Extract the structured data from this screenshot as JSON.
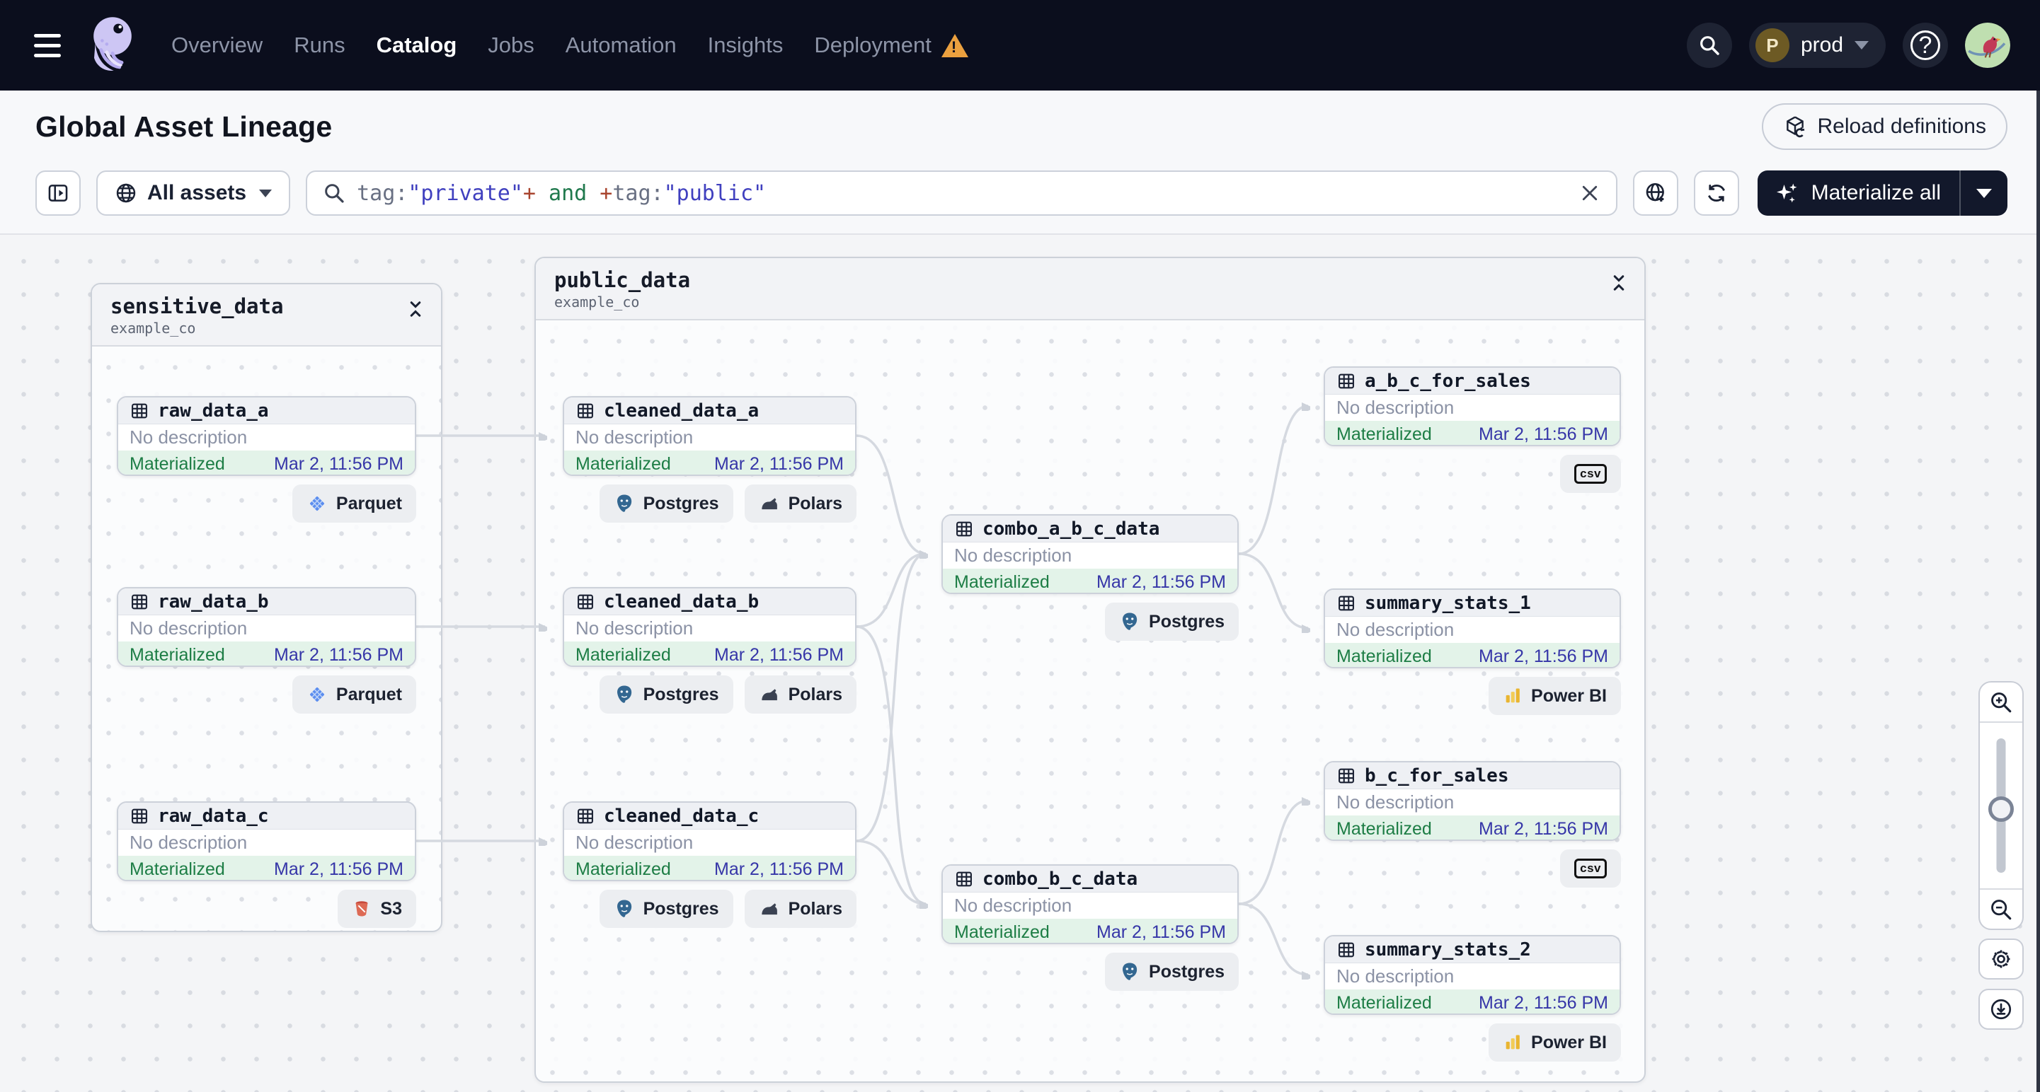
{
  "nav": {
    "items": [
      {
        "label": "Overview"
      },
      {
        "label": "Runs"
      },
      {
        "label": "Catalog"
      },
      {
        "label": "Jobs"
      },
      {
        "label": "Automation"
      },
      {
        "label": "Insights"
      },
      {
        "label": "Deployment"
      }
    ],
    "active_item": "Catalog",
    "deployment_warning": true,
    "environment": {
      "initial": "P",
      "label": "prod"
    }
  },
  "header": {
    "title": "Global Asset Lineage",
    "reload_label": "Reload definitions"
  },
  "toolbar": {
    "scope_label": "All assets",
    "materialize_label": "Materialize all",
    "query_segments": [
      {
        "text": "tag:",
        "color": "#697083"
      },
      {
        "text": "\"private\"",
        "color": "#4040bf"
      },
      {
        "text": "+",
        "color": "#a8442e"
      },
      {
        "text": " and ",
        "color": "#20794d"
      },
      {
        "text": "+",
        "color": "#a8442e"
      },
      {
        "text": "tag:",
        "color": "#697083"
      },
      {
        "text": "\"public\"",
        "color": "#4040bf"
      }
    ]
  },
  "graph": {
    "groups": [
      {
        "name": "sensitive_data",
        "repo": "example_co"
      },
      {
        "name": "public_data",
        "repo": "example_co"
      }
    ],
    "nodes": [
      {
        "name": "raw_data_a",
        "description": "No description",
        "status": "Materialized",
        "timestamp": "Mar 2, 11:56 PM",
        "badges": [
          {
            "icon": "parquet-icon",
            "label": "Parquet"
          }
        ]
      },
      {
        "name": "raw_data_b",
        "description": "No description",
        "status": "Materialized",
        "timestamp": "Mar 2, 11:56 PM",
        "badges": [
          {
            "icon": "parquet-icon",
            "label": "Parquet"
          }
        ]
      },
      {
        "name": "raw_data_c",
        "description": "No description",
        "status": "Materialized",
        "timestamp": "Mar 2, 11:56 PM",
        "badges": [
          {
            "icon": "s3-icon",
            "label": "S3"
          }
        ]
      },
      {
        "name": "cleaned_data_a",
        "description": "No description",
        "status": "Materialized",
        "timestamp": "Mar 2, 11:56 PM",
        "badges": [
          {
            "icon": "postgres-icon",
            "label": "Postgres"
          },
          {
            "icon": "polars-icon",
            "label": "Polars"
          }
        ]
      },
      {
        "name": "cleaned_data_b",
        "description": "No description",
        "status": "Materialized",
        "timestamp": "Mar 2, 11:56 PM",
        "badges": [
          {
            "icon": "postgres-icon",
            "label": "Postgres"
          },
          {
            "icon": "polars-icon",
            "label": "Polars"
          }
        ]
      },
      {
        "name": "cleaned_data_c",
        "description": "No description",
        "status": "Materialized",
        "timestamp": "Mar 2, 11:56 PM",
        "badges": [
          {
            "icon": "postgres-icon",
            "label": "Postgres"
          },
          {
            "icon": "polars-icon",
            "label": "Polars"
          }
        ]
      },
      {
        "name": "combo_a_b_c_data",
        "description": "No description",
        "status": "Materialized",
        "timestamp": "Mar 2, 11:56 PM",
        "badges": [
          {
            "icon": "postgres-icon",
            "label": "Postgres"
          }
        ]
      },
      {
        "name": "combo_b_c_data",
        "description": "No description",
        "status": "Materialized",
        "timestamp": "Mar 2, 11:56 PM",
        "badges": [
          {
            "icon": "postgres-icon",
            "label": "Postgres"
          }
        ]
      },
      {
        "name": "a_b_c_for_sales",
        "description": "No description",
        "status": "Materialized",
        "timestamp": "Mar 2, 11:56 PM",
        "badges": [
          {
            "icon": "csv-icon",
            "label": "csv"
          }
        ]
      },
      {
        "name": "summary_stats_1",
        "description": "No description",
        "status": "Materialized",
        "timestamp": "Mar 2, 11:56 PM",
        "badges": [
          {
            "icon": "powerbi-icon",
            "label": "Power BI"
          }
        ]
      },
      {
        "name": "b_c_for_sales",
        "description": "No description",
        "status": "Materialized",
        "timestamp": "Mar 2, 11:56 PM",
        "badges": [
          {
            "icon": "csv-icon",
            "label": "csv"
          }
        ]
      },
      {
        "name": "summary_stats_2",
        "description": "No description",
        "status": "Materialized",
        "timestamp": "Mar 2, 11:56 PM",
        "badges": [
          {
            "icon": "powerbi-icon",
            "label": "Power BI"
          }
        ]
      }
    ],
    "edges": [
      {
        "from": "raw_data_a",
        "to": "cleaned_data_a"
      },
      {
        "from": "raw_data_b",
        "to": "cleaned_data_b"
      },
      {
        "from": "raw_data_c",
        "to": "cleaned_data_c"
      },
      {
        "from": "cleaned_data_a",
        "to": "combo_a_b_c_data"
      },
      {
        "from": "cleaned_data_b",
        "to": "combo_a_b_c_data"
      },
      {
        "from": "cleaned_data_c",
        "to": "combo_a_b_c_data"
      },
      {
        "from": "cleaned_data_b",
        "to": "combo_b_c_data"
      },
      {
        "from": "cleaned_data_c",
        "to": "combo_b_c_data"
      },
      {
        "from": "combo_a_b_c_data",
        "to": "a_b_c_for_sales"
      },
      {
        "from": "combo_a_b_c_data",
        "to": "summary_stats_1"
      },
      {
        "from": "combo_b_c_data",
        "to": "b_c_for_sales"
      },
      {
        "from": "combo_b_c_data",
        "to": "summary_stats_2"
      }
    ]
  },
  "colors": {
    "nav_bg": "#0b0e1d",
    "accent_dark_button": "#12182b",
    "status_green": "#1d7d45",
    "status_bg": "#e3f3e9",
    "timestamp_indigo": "#3636a8",
    "edge": "#d5d9e0",
    "warning_orange": "#eba03f"
  }
}
